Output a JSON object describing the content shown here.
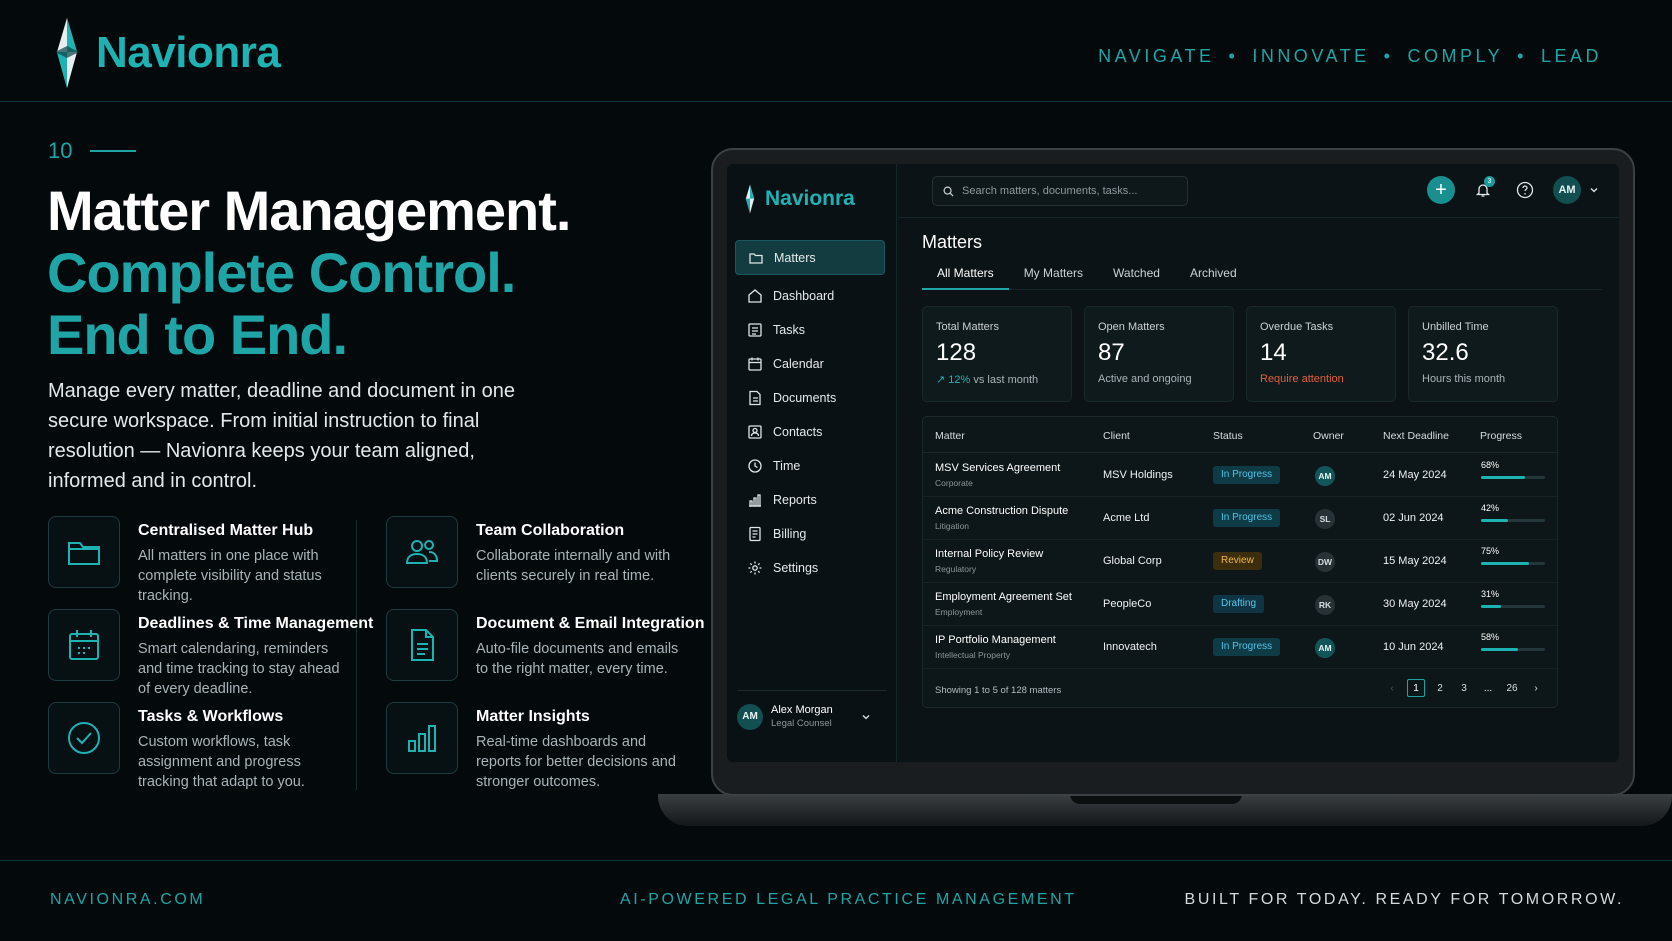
{
  "brand": {
    "name": "Navionra"
  },
  "tagline": [
    "NAVIGATE",
    "INNOVATE",
    "COMPLY",
    "LEAD"
  ],
  "slide": {
    "number": "10",
    "headline": [
      "Matter Management.",
      "Complete Control.",
      "End to End."
    ],
    "intro": "Manage every matter, deadline and document in one secure workspace. From initial instruction to final resolution — Navionra keeps your team aligned, informed and in control."
  },
  "features": [
    {
      "icon": "folder-icon",
      "title": "Centralised Matter Hub",
      "desc": "All matters in one place with complete visibility and status tracking."
    },
    {
      "icon": "team-icon",
      "title": "Team Collaboration",
      "desc": "Collaborate internally and with clients securely in real time."
    },
    {
      "icon": "calendar-icon",
      "title": "Deadlines & Time Management",
      "desc": "Smart calendaring, reminders and time tracking to stay ahead of every deadline."
    },
    {
      "icon": "document-icon",
      "title": "Document & Email Integration",
      "desc": "Auto-file documents and emails to the right matter, every time."
    },
    {
      "icon": "check-circle-icon",
      "title": "Tasks & Workflows",
      "desc": "Custom workflows, task assignment and progress tracking that adapt to you."
    },
    {
      "icon": "bar-chart-icon",
      "title": "Matter Insights",
      "desc": "Real-time dashboards and reports for better decisions and stronger outcomes."
    }
  ],
  "footer": {
    "website": "NAVIONRA.COM",
    "category": "AI-POWERED LEGAL PRACTICE MANAGEMENT",
    "slogan": "BUILT FOR TODAY. READY FOR TOMORROW."
  },
  "app": {
    "brand": "Navionra",
    "nav": [
      {
        "label": "Matters",
        "icon": "folder-icon",
        "active": true
      },
      {
        "label": "Dashboard",
        "icon": "home-icon"
      },
      {
        "label": "Tasks",
        "icon": "tasks-icon"
      },
      {
        "label": "Calendar",
        "icon": "calendar-icon"
      },
      {
        "label": "Documents",
        "icon": "document-icon"
      },
      {
        "label": "Contacts",
        "icon": "contacts-icon"
      },
      {
        "label": "Time",
        "icon": "clock-icon"
      },
      {
        "label": "Reports",
        "icon": "bar-chart-icon"
      },
      {
        "label": "Billing",
        "icon": "billing-icon"
      },
      {
        "label": "Settings",
        "icon": "gear-icon"
      }
    ],
    "user": {
      "initials": "AM",
      "name": "Alex Morgan",
      "role": "Legal Counsel"
    },
    "search": {
      "placeholder": "Search matters, documents, tasks..."
    },
    "notifications": {
      "count": "3"
    },
    "top_user": {
      "initials": "AM"
    },
    "page_title": "Matters",
    "tabs": [
      "All Matters",
      "My Matters",
      "Watched",
      "Archived"
    ],
    "stats": [
      {
        "label": "Total Matters",
        "value": "128",
        "change": "12%",
        "sub": "vs last month"
      },
      {
        "label": "Open Matters",
        "value": "87",
        "sub": "Active and ongoing"
      },
      {
        "label": "Overdue Tasks",
        "value": "14",
        "sub": "Require attention",
        "warn": true
      },
      {
        "label": "Unbilled Time",
        "value": "32.6",
        "sub": "Hours this month"
      }
    ],
    "table": {
      "columns": [
        "Matter",
        "Client",
        "Status",
        "Owner",
        "Next Deadline",
        "Progress"
      ],
      "rows": [
        {
          "matter": "MSV Services Agreement",
          "type": "Corporate",
          "client": "MSV Holdings",
          "status": "In Progress",
          "owner": "AM",
          "deadline": "24 May 2024",
          "progress": "68%",
          "progress_value": 68
        },
        {
          "matter": "Acme Construction Dispute",
          "type": "Litigation",
          "client": "Acme Ltd",
          "status": "In Progress",
          "owner": "SL",
          "deadline": "02 Jun 2024",
          "progress": "42%",
          "progress_value": 42
        },
        {
          "matter": "Internal Policy Review",
          "type": "Regulatory",
          "client": "Global Corp",
          "status": "Review",
          "owner": "DW",
          "deadline": "15 May 2024",
          "progress": "75%",
          "progress_value": 75
        },
        {
          "matter": "Employment Agreement Set",
          "type": "Employment",
          "client": "PeopleCo",
          "status": "Drafting",
          "owner": "RK",
          "deadline": "30 May 2024",
          "progress": "31%",
          "progress_value": 31
        },
        {
          "matter": "IP Portfolio Management",
          "type": "Intellectual Property",
          "client": "Innovatech",
          "status": "In Progress",
          "owner": "AM",
          "deadline": "10 Jun 2024",
          "progress": "58%",
          "progress_value": 58
        }
      ],
      "showing": "Showing 1 to 5 of 128 matters",
      "pages": [
        "1",
        "2",
        "3",
        "...",
        "26"
      ]
    },
    "colors": {
      "accent": "#1fa5a6",
      "warning": "#e0603a",
      "review": "#f0b84a",
      "info": "#4fc3e6"
    }
  }
}
